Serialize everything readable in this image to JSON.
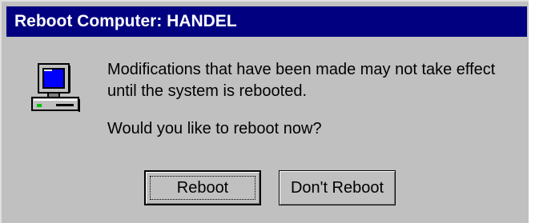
{
  "window": {
    "title": "Reboot Computer:  HANDEL"
  },
  "message": {
    "line1": "Modifications that have been made may not take effect",
    "line2": "until the system is rebooted.",
    "question": "Would you like to reboot now?"
  },
  "buttons": {
    "reboot_label": "Reboot",
    "dont_reboot_label": "Don't Reboot"
  },
  "icons": {
    "computer": "computer-icon"
  },
  "colors": {
    "titlebar": "#000080",
    "face": "#c0c0c0",
    "screen": "#0000ff"
  }
}
